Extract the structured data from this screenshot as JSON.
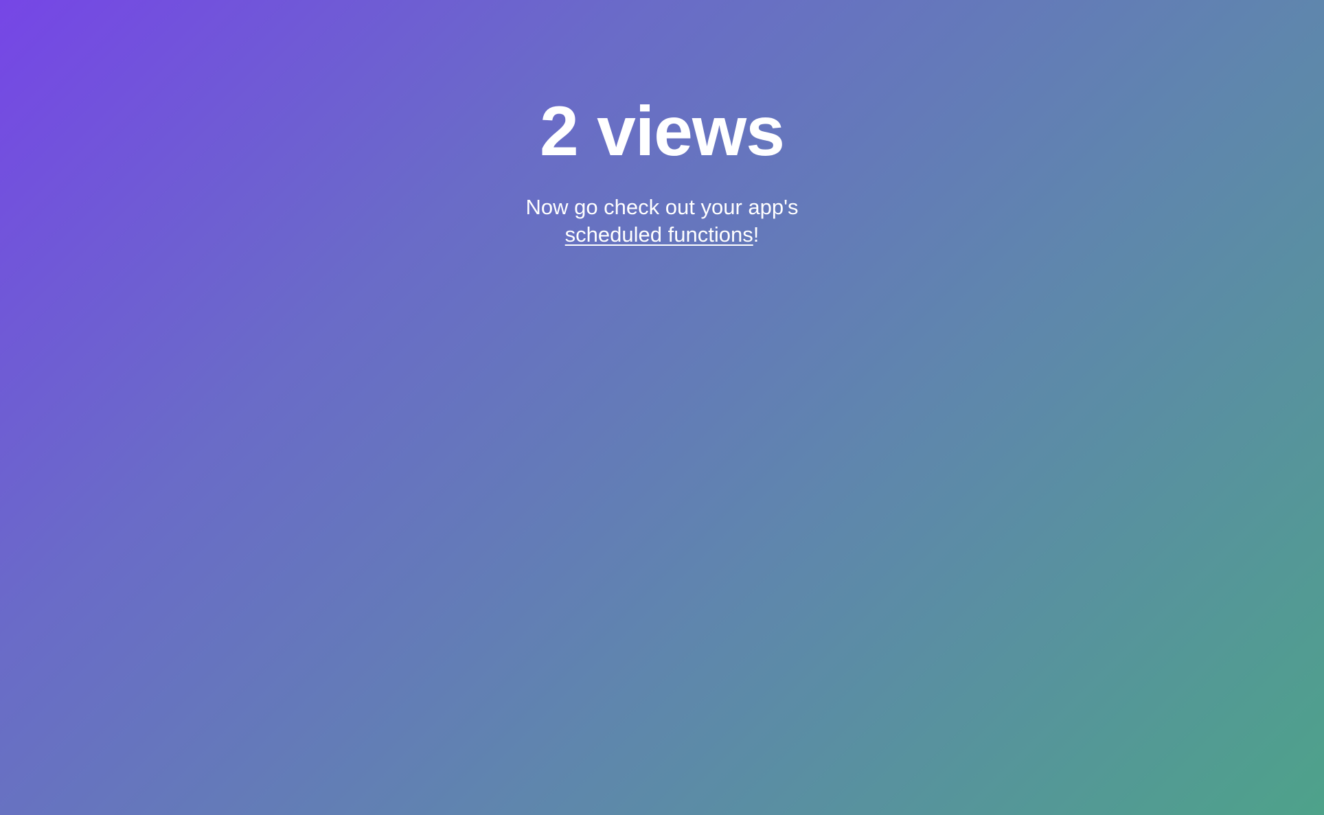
{
  "hero": {
    "headline": "2 views",
    "message_prefix": "Now go check out your app's",
    "link_text": "scheduled functions",
    "message_suffix": "!"
  },
  "colors": {
    "gradient_start": "#7646e6",
    "gradient_mid": "#5f86ad",
    "gradient_end": "#4ea28a",
    "text": "#ffffff"
  }
}
